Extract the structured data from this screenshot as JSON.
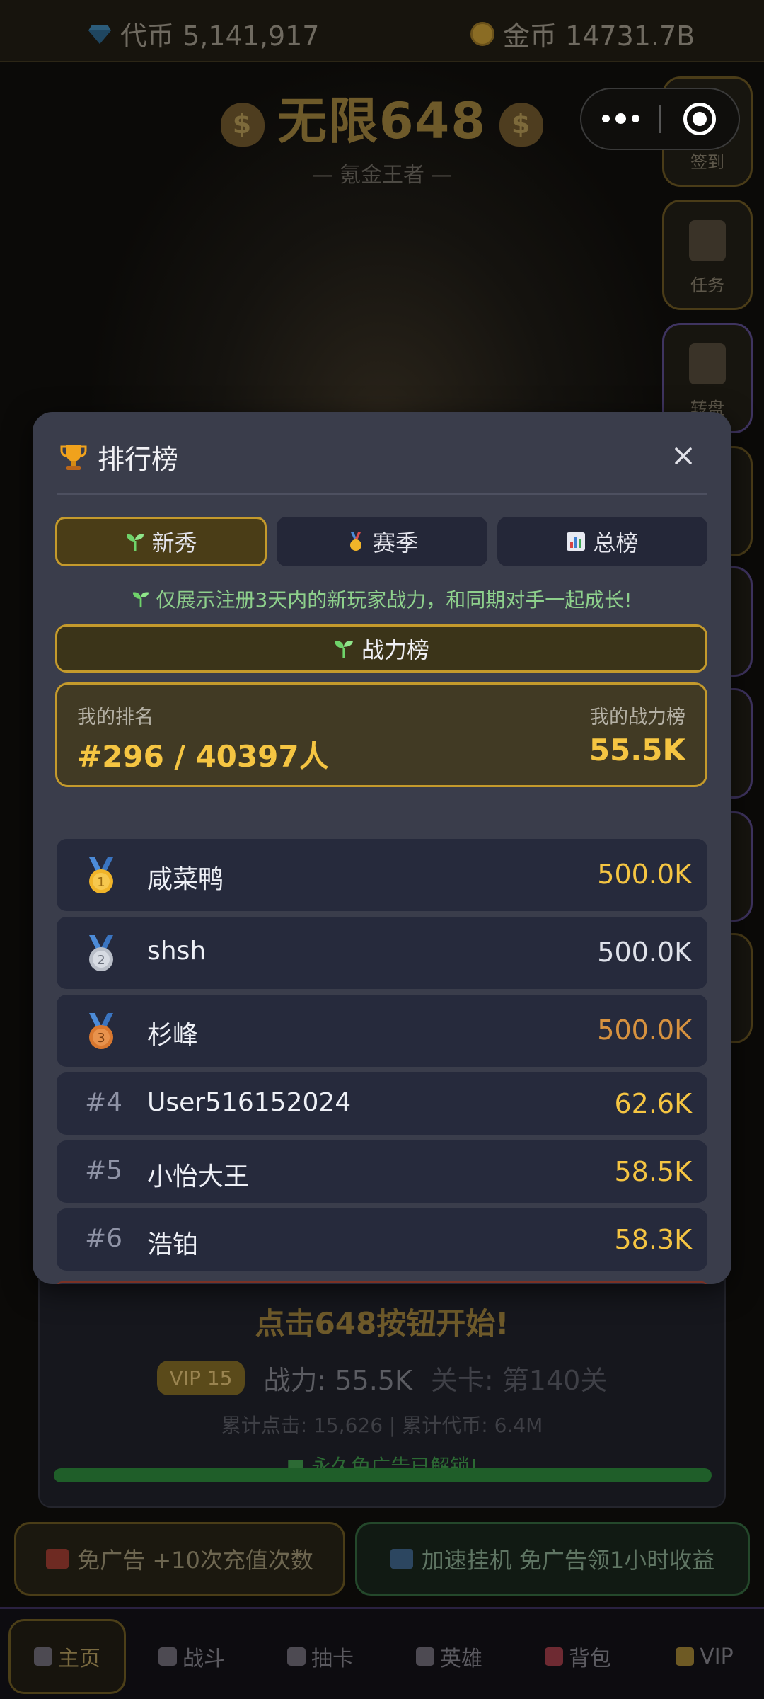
{
  "currency": {
    "token_label": "代币 5,141,917",
    "gold_label": "金币 14731.7B"
  },
  "header": {
    "title": "无限648",
    "subtitle": "— 氪金王者 —"
  },
  "side_buttons": [
    {
      "label": "签到"
    },
    {
      "label": "任务"
    },
    {
      "label": "转盘"
    }
  ],
  "modal": {
    "title": "排行榜",
    "tabs": [
      {
        "label": "新秀",
        "active": true
      },
      {
        "label": "赛季",
        "active": false
      },
      {
        "label": "总榜",
        "active": false
      }
    ],
    "hint": "仅展示注册3天内的新玩家战力，和同期对手一起成长!",
    "sub_tab": "战力榜",
    "my": {
      "rank_label": "我的排名",
      "rank_value": "#296 / 40397人",
      "power_label": "我的战力榜",
      "power_value": "55.5K"
    },
    "rows": [
      {
        "rank": "1",
        "name": "咸菜鸭",
        "score": "500.0K"
      },
      {
        "rank": "2",
        "name": "shsh",
        "score": "500.0K"
      },
      {
        "rank": "3",
        "name": "杉峰",
        "score": "500.0K"
      },
      {
        "rank": "#4",
        "name": "User516152024",
        "score": "62.6K"
      },
      {
        "rank": "#5",
        "name": "小怡大王",
        "score": "58.5K"
      },
      {
        "rank": "#6",
        "name": "浩铂",
        "score": "58.3K"
      }
    ]
  },
  "panel": {
    "start_text": "点击648按钮开始!",
    "vip": "VIP 15",
    "power": "战力: 55.5K",
    "stage": "关卡: 第140关",
    "stats": "累计点击: 15,626 | 累计代币: 6.4M",
    "ad_unlocked": "永久免广告已解锁!",
    "progress": 1.0
  },
  "actions": {
    "no_ad": "免广告 +10次充值次数",
    "speed": "加速挂机 免广告领1小时收益"
  },
  "tabbar": [
    {
      "label": "主页",
      "active": true
    },
    {
      "label": "战斗",
      "active": false
    },
    {
      "label": "抽卡",
      "active": false
    },
    {
      "label": "英雄",
      "active": false
    },
    {
      "label": "背包",
      "active": false
    },
    {
      "label": "VIP",
      "active": false
    }
  ],
  "colors": {
    "accent_gold": "#f5c542",
    "modal_bg": "#3a3d4b",
    "row_bg": "#262a3c",
    "hint_green": "#8ed08c"
  }
}
